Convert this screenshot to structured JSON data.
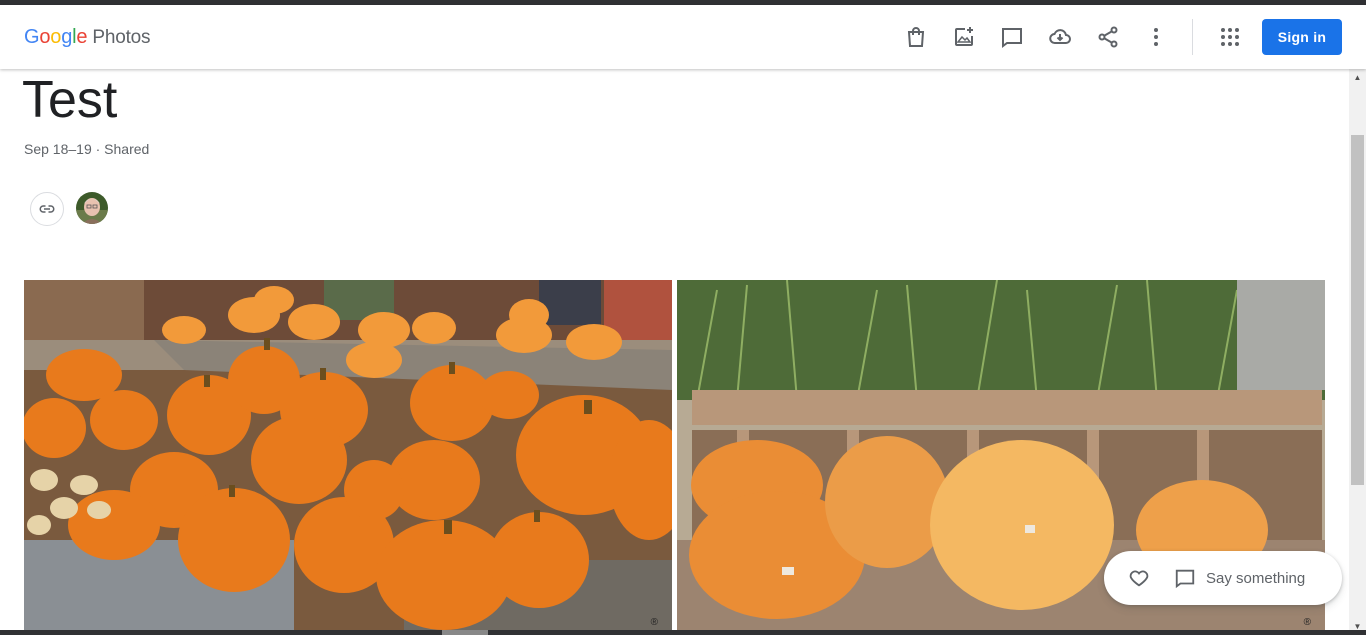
{
  "header": {
    "logo_letters": [
      {
        "ch": "G",
        "color": "#4285F4"
      },
      {
        "ch": "o",
        "color": "#EA4335"
      },
      {
        "ch": "o",
        "color": "#FBBC05"
      },
      {
        "ch": "g",
        "color": "#4285F4"
      },
      {
        "ch": "l",
        "color": "#34A853"
      },
      {
        "ch": "e",
        "color": "#EA4335"
      }
    ],
    "logo_text": "Google",
    "product": "Photos",
    "toolbar_icons": [
      "shopping-bag-icon",
      "add-photo-icon",
      "comment-icon",
      "cloud-download-icon",
      "share-icon",
      "more-vert-icon"
    ],
    "apps_icon": "apps-grid-icon",
    "sign_in_label": "Sign in",
    "accent_color": "#1a73e8"
  },
  "album": {
    "title": "Test",
    "meta": "Sep 18–19 · Shared",
    "link_icon": "link-icon",
    "avatar": "user-avatar"
  },
  "photos": [
    {
      "subject": "pumpkins-on-pallets",
      "watermark": "®"
    },
    {
      "subject": "pumpkins-on-bench",
      "watermark": "®"
    }
  ],
  "comment_bar": {
    "like_icon": "heart-icon",
    "comment_icon": "comment-icon",
    "placeholder": "Say something"
  }
}
